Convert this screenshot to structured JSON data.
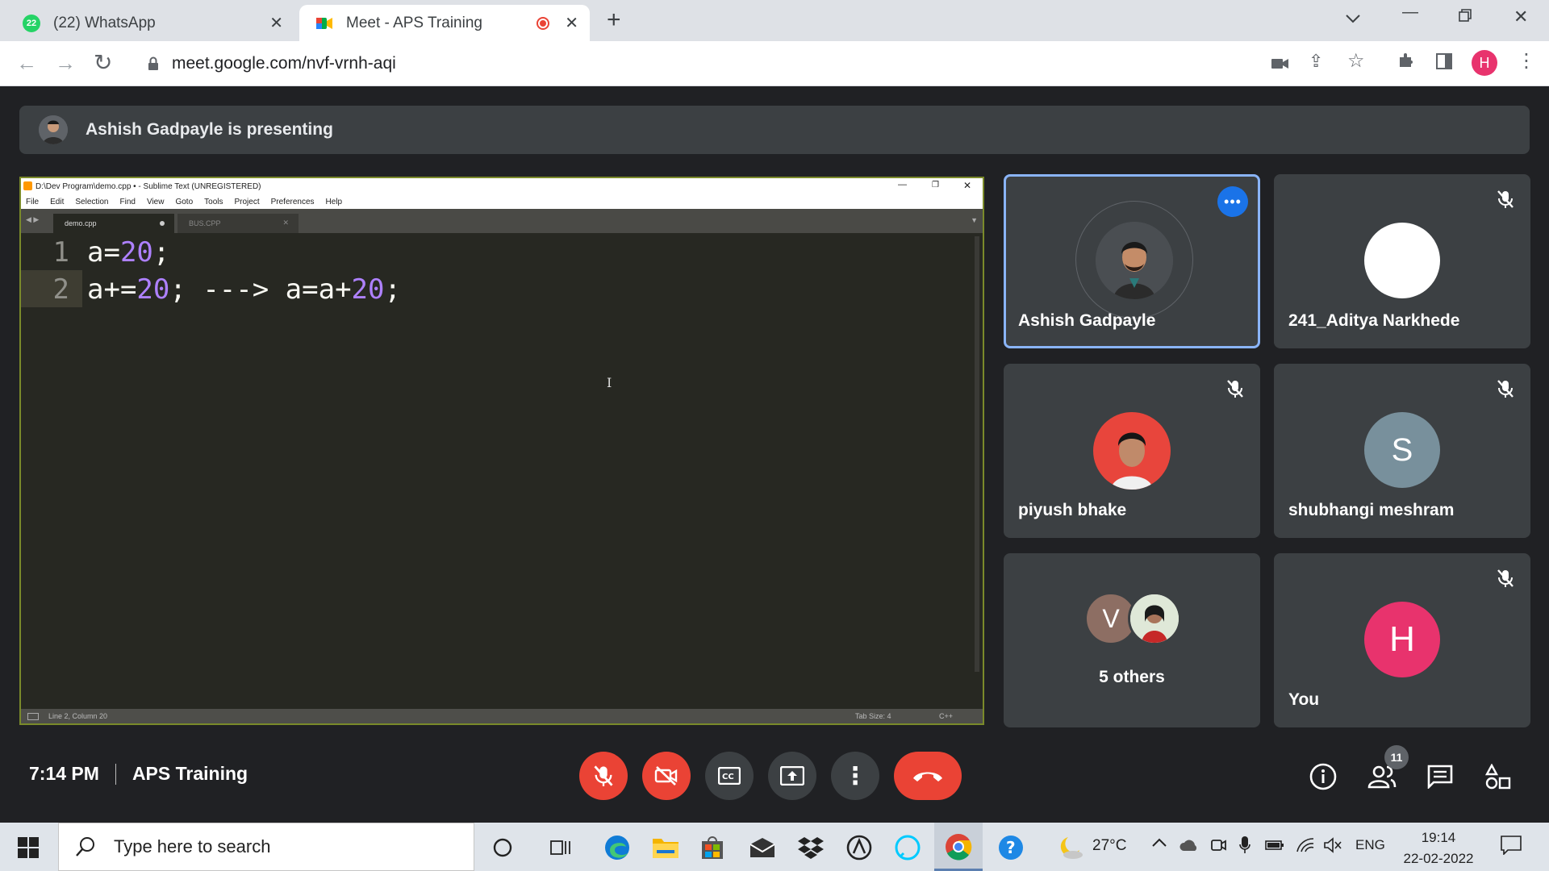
{
  "browser": {
    "tabs": [
      {
        "label": "(22) WhatsApp",
        "badge": "22"
      },
      {
        "label": "Meet - APS Training"
      }
    ],
    "url": "meet.google.com/nvf-vrnh-aqi",
    "profile_initial": "H"
  },
  "meet": {
    "presenting_text": "Ashish Gadpayle is presenting",
    "meeting_time": "7:14 PM",
    "meeting_name": "APS Training",
    "participants_count": "11",
    "tiles": [
      {
        "name": "Ashish Gadpayle"
      },
      {
        "name": "241_Aditya Narkhede"
      },
      {
        "name": "piyush bhake"
      },
      {
        "name": "shubhangi meshram",
        "initial": "S"
      },
      {
        "name": "5 others",
        "initial": "V"
      },
      {
        "name": "You",
        "initial": "H"
      }
    ]
  },
  "editor": {
    "title": "D:\\Dev Program\\demo.cpp • - Sublime Text (UNREGISTERED)",
    "menu": [
      "File",
      "Edit",
      "Selection",
      "Find",
      "View",
      "Goto",
      "Tools",
      "Project",
      "Preferences",
      "Help"
    ],
    "tabs": [
      "demo.cpp",
      "BUS.CPP"
    ],
    "lines": [
      {
        "no": "1",
        "pre": "a=",
        "num": "20",
        "post": ";"
      },
      {
        "no": "2",
        "pre": "a+=",
        "num": "20",
        "mid": "; ---> a=a+",
        "num2": "20",
        "post": ";"
      }
    ],
    "status_left": "Line 2, Column 20",
    "status_tab": "Tab Size: 4",
    "status_syntax": "C++"
  },
  "taskbar": {
    "search_placeholder": "Type here to search",
    "weather": "27°C",
    "language": "ENG",
    "time": "19:14",
    "date": "22-02-2022"
  },
  "colors": {
    "meet_red": "#ea4335",
    "active_border": "#8ab4f8",
    "you_avatar": "#e8336d",
    "s_avatar": "#78909c",
    "v_avatar": "#8d6e63"
  }
}
